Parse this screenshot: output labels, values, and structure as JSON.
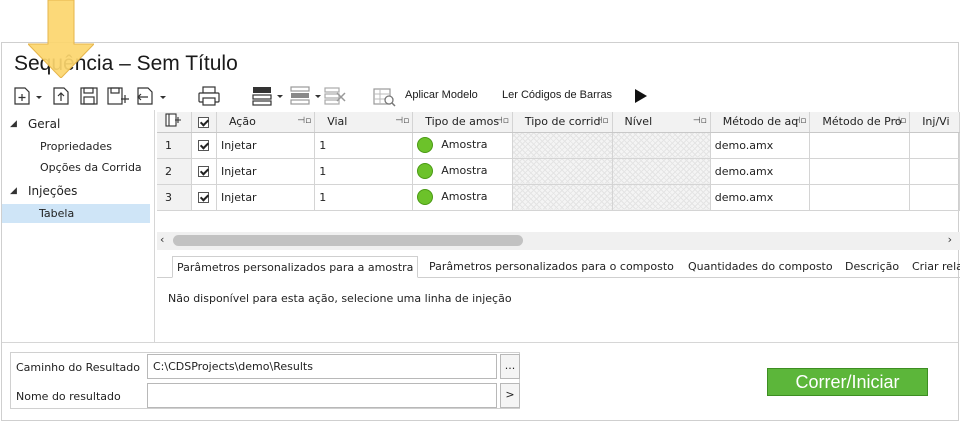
{
  "window": {
    "title": "Sequência – Sem Título"
  },
  "toolbar": {
    "apply_model": "Aplicar Modelo",
    "read_barcodes": "Ler Códigos de Barras"
  },
  "sidebar": {
    "groups": [
      {
        "label": "Geral",
        "items": [
          "Propriedades",
          "Opções da Corrida"
        ]
      },
      {
        "label": "Injeções",
        "items": [
          "Tabela"
        ]
      }
    ]
  },
  "grid": {
    "columns": [
      "Ação",
      "Vial",
      "Tipo de amos",
      "Tipo de corrid",
      "Nível",
      "Método de aq",
      "Método de Pro",
      "Inj/Vi"
    ],
    "rows": [
      {
        "num": "1",
        "action": "Injetar",
        "vial": "1",
        "sample_type": "Amostra",
        "run_type": "",
        "level": "",
        "acq_method": "demo.amx",
        "proc_method": ""
      },
      {
        "num": "2",
        "action": "Injetar",
        "vial": "1",
        "sample_type": "Amostra",
        "run_type": "",
        "level": "",
        "acq_method": "demo.amx",
        "proc_method": ""
      },
      {
        "num": "3",
        "action": "Injetar",
        "vial": "1",
        "sample_type": "Amostra",
        "run_type": "",
        "level": "",
        "acq_method": "demo.amx",
        "proc_method": ""
      }
    ]
  },
  "tabs": {
    "items": [
      "Parâmetros personalizados para a amostra",
      "Parâmetros personalizados para o composto",
      "Quantidades do composto",
      "Descrição",
      "Criar rela"
    ],
    "message": "Não disponível para esta ação, selecione uma linha de injeção"
  },
  "form": {
    "result_path_label": "Caminho do Resultado",
    "result_path_value": "C:\\CDSProjects\\demo\\Results",
    "browse_label": "...",
    "result_name_label": "Nome do resultado",
    "result_name_value": "",
    "expand_label": ">"
  },
  "run_button": {
    "label": "Correr/Iniciar",
    "color": "#5cb63a"
  },
  "highlight_arrow": {
    "color": "#fcd66e",
    "icon": "down-arrow-highlight"
  }
}
